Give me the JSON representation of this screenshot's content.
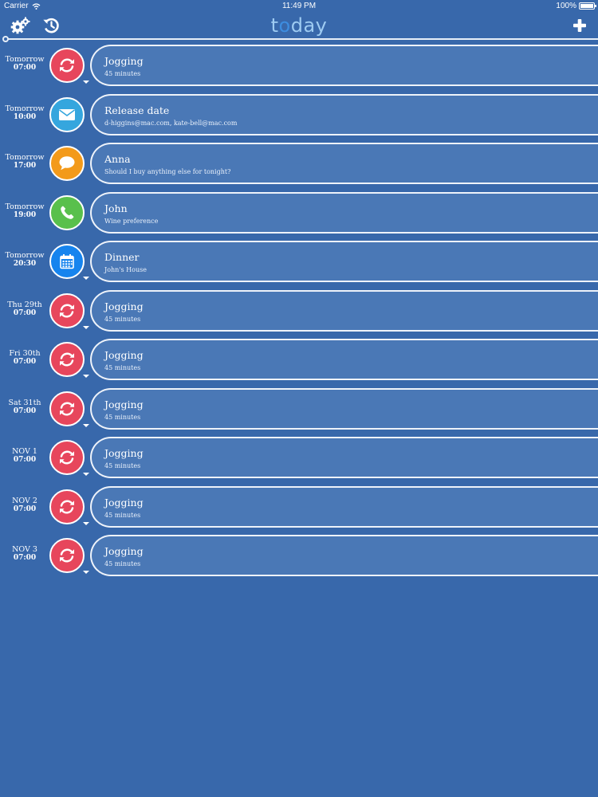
{
  "status_bar": {
    "carrier": "Carrier",
    "time": "11:49 PM",
    "battery": "100%"
  },
  "header": {
    "title_part1": "t",
    "title_part2": "o",
    "title_part3": "day"
  },
  "icons": {
    "settings": "gear-icon",
    "history": "history-icon",
    "add": "plus-icon"
  },
  "colors": {
    "background": "#3868ab",
    "repeat": "#e7465c",
    "mail": "#35a6de",
    "message": "#f39a1a",
    "phone": "#59c04c",
    "calendar": "#1684ee"
  },
  "items": [
    {
      "day": "Tomorrow",
      "time": "07:00",
      "type": "repeat",
      "title": "Jogging",
      "subtitle": "45 minutes"
    },
    {
      "day": "Tomorrow",
      "time": "10:00",
      "type": "mail",
      "title": "Release date",
      "subtitle": "d-higgins@mac.com, kate-bell@mac.com"
    },
    {
      "day": "Tomorrow",
      "time": "17:00",
      "type": "message",
      "title": "Anna",
      "subtitle": "Should I buy anything else for tonight?"
    },
    {
      "day": "Tomorrow",
      "time": "19:00",
      "type": "phone",
      "title": "John",
      "subtitle": "Wine preference"
    },
    {
      "day": "Tomorrow",
      "time": "20:30",
      "type": "calendar",
      "title": "Dinner",
      "subtitle": "John's House"
    },
    {
      "day": "Thu 29th",
      "time": "07:00",
      "type": "repeat",
      "title": "Jogging",
      "subtitle": "45 minutes"
    },
    {
      "day": "Fri 30th",
      "time": "07:00",
      "type": "repeat",
      "title": "Jogging",
      "subtitle": "45 minutes"
    },
    {
      "day": "Sat 31th",
      "time": "07:00",
      "type": "repeat",
      "title": "Jogging",
      "subtitle": "45 minutes"
    },
    {
      "day": "NOV 1",
      "time": "07:00",
      "type": "repeat",
      "title": "Jogging",
      "subtitle": "45 minutes"
    },
    {
      "day": "NOV 2",
      "time": "07:00",
      "type": "repeat",
      "title": "Jogging",
      "subtitle": "45 minutes"
    },
    {
      "day": "NOV 3",
      "time": "07:00",
      "type": "repeat",
      "title": "Jogging",
      "subtitle": "45 minutes"
    }
  ]
}
